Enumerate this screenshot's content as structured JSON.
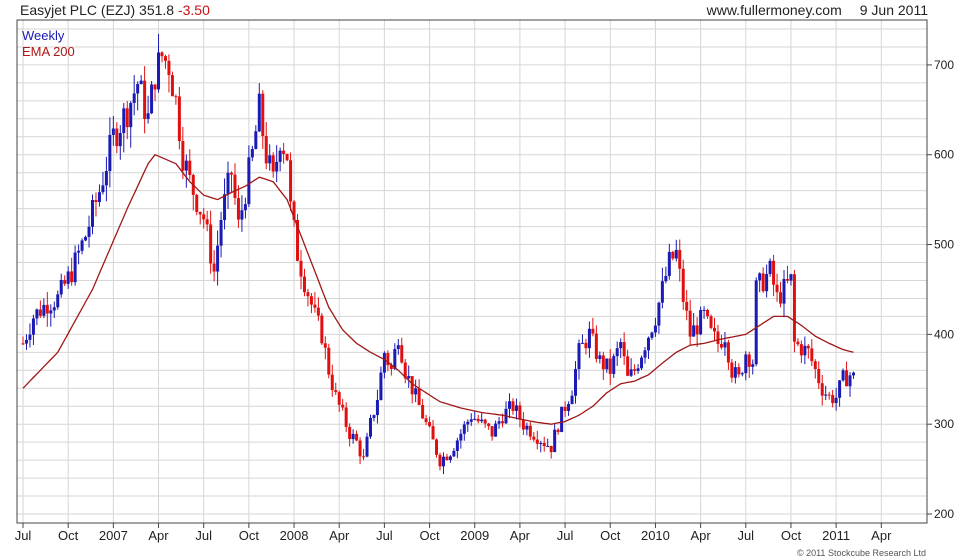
{
  "header": {
    "title": "Easyjet PLC (EZJ) 351.8",
    "change": "-3.50",
    "site": "www.fullermoney.com",
    "date": "9 Jun 2011"
  },
  "legend": {
    "weekly": "Weekly",
    "ema": "EMA 200"
  },
  "footer": {
    "copyright": "© 2011 Stockcube Research Ltd"
  },
  "colors": {
    "up_candle": "#1a1ab4",
    "down_candle": "#e01010",
    "ema_line": "#a01818",
    "grid": "#d6d6d6",
    "axis": "#444444"
  },
  "chart_data": {
    "type": "candlestick",
    "grid": true,
    "ylim": [
      190,
      750
    ],
    "y_axis_side": "right",
    "y_ticks": [
      200,
      300,
      400,
      500,
      600,
      700
    ],
    "x_ticks": [
      "Jul",
      "Oct",
      "2007",
      "Apr",
      "Jul",
      "Oct",
      "2008",
      "Apr",
      "Jul",
      "Oct",
      "2009",
      "Apr",
      "Jul",
      "Oct",
      "2010",
      "Apr",
      "Jul",
      "Oct",
      "2011",
      "Apr"
    ],
    "x_tick_weeks": [
      0,
      13,
      26,
      39,
      52,
      65,
      78,
      91,
      104,
      117,
      130,
      143,
      156,
      169,
      182,
      195,
      208,
      221,
      234,
      247
    ],
    "weeks": 259,
    "price_anchors": [
      [
        0,
        390
      ],
      [
        3,
        420
      ],
      [
        7,
        435
      ],
      [
        10,
        440
      ],
      [
        14,
        470
      ],
      [
        18,
        510
      ],
      [
        22,
        560
      ],
      [
        26,
        620
      ],
      [
        30,
        650
      ],
      [
        33,
        680
      ],
      [
        36,
        640
      ],
      [
        38,
        690
      ],
      [
        40,
        710
      ],
      [
        42,
        700
      ],
      [
        44,
        660
      ],
      [
        46,
        600
      ],
      [
        48,
        570
      ],
      [
        52,
        530
      ],
      [
        55,
        470
      ],
      [
        57,
        530
      ],
      [
        60,
        580
      ],
      [
        62,
        520
      ],
      [
        64,
        560
      ],
      [
        66,
        600
      ],
      [
        68,
        650
      ],
      [
        70,
        600
      ],
      [
        72,
        570
      ],
      [
        74,
        620
      ],
      [
        76,
        600
      ],
      [
        77,
        540
      ],
      [
        79,
        490
      ],
      [
        81,
        460
      ],
      [
        84,
        420
      ],
      [
        86,
        400
      ],
      [
        88,
        360
      ],
      [
        90,
        330
      ],
      [
        92,
        310
      ],
      [
        94,
        290
      ],
      [
        96,
        280
      ],
      [
        98,
        260
      ],
      [
        100,
        300
      ],
      [
        102,
        330
      ],
      [
        104,
        380
      ],
      [
        106,
        360
      ],
      [
        108,
        400
      ],
      [
        110,
        360
      ],
      [
        112,
        340
      ],
      [
        115,
        310
      ],
      [
        118,
        280
      ],
      [
        120,
        260
      ],
      [
        123,
        270
      ],
      [
        126,
        290
      ],
      [
        129,
        310
      ],
      [
        132,
        300
      ],
      [
        135,
        290
      ],
      [
        138,
        310
      ],
      [
        141,
        320
      ],
      [
        144,
        300
      ],
      [
        147,
        290
      ],
      [
        150,
        280
      ],
      [
        152,
        275
      ],
      [
        154,
        300
      ],
      [
        156,
        320
      ],
      [
        158,
        340
      ],
      [
        160,
        380
      ],
      [
        163,
        400
      ],
      [
        166,
        370
      ],
      [
        169,
        360
      ],
      [
        172,
        390
      ],
      [
        174,
        350
      ],
      [
        176,
        360
      ],
      [
        178,
        380
      ],
      [
        180,
        400
      ],
      [
        182,
        420
      ],
      [
        184,
        450
      ],
      [
        186,
        480
      ],
      [
        188,
        490
      ],
      [
        190,
        440
      ],
      [
        192,
        400
      ],
      [
        194,
        410
      ],
      [
        196,
        420
      ],
      [
        198,
        400
      ],
      [
        200,
        390
      ],
      [
        202,
        400
      ],
      [
        204,
        360
      ],
      [
        206,
        350
      ],
      [
        208,
        380
      ],
      [
        210,
        370
      ],
      [
        211,
        450
      ],
      [
        213,
        460
      ],
      [
        215,
        470
      ],
      [
        217,
        440
      ],
      [
        219,
        450
      ],
      [
        221,
        460
      ],
      [
        222,
        390
      ],
      [
        224,
        385
      ],
      [
        226,
        380
      ],
      [
        228,
        360
      ],
      [
        230,
        340
      ],
      [
        232,
        330
      ],
      [
        234,
        330
      ],
      [
        236,
        350
      ],
      [
        238,
        355
      ],
      [
        239,
        352
      ]
    ],
    "ema_anchors": [
      [
        0,
        340
      ],
      [
        10,
        380
      ],
      [
        20,
        450
      ],
      [
        30,
        540
      ],
      [
        36,
        590
      ],
      [
        38,
        600
      ],
      [
        44,
        590
      ],
      [
        48,
        570
      ],
      [
        52,
        555
      ],
      [
        56,
        550
      ],
      [
        60,
        558
      ],
      [
        64,
        565
      ],
      [
        68,
        575
      ],
      [
        72,
        570
      ],
      [
        76,
        550
      ],
      [
        80,
        510
      ],
      [
        84,
        470
      ],
      [
        88,
        430
      ],
      [
        92,
        405
      ],
      [
        96,
        390
      ],
      [
        100,
        380
      ],
      [
        104,
        372
      ],
      [
        108,
        360
      ],
      [
        112,
        345
      ],
      [
        116,
        335
      ],
      [
        120,
        325
      ],
      [
        126,
        318
      ],
      [
        132,
        313
      ],
      [
        138,
        310
      ],
      [
        144,
        305
      ],
      [
        148,
        302
      ],
      [
        152,
        300
      ],
      [
        156,
        303
      ],
      [
        160,
        310
      ],
      [
        164,
        320
      ],
      [
        168,
        335
      ],
      [
        172,
        345
      ],
      [
        176,
        348
      ],
      [
        180,
        355
      ],
      [
        184,
        368
      ],
      [
        188,
        380
      ],
      [
        192,
        388
      ],
      [
        196,
        390
      ],
      [
        200,
        394
      ],
      [
        204,
        397
      ],
      [
        208,
        400
      ],
      [
        212,
        410
      ],
      [
        216,
        420
      ],
      [
        220,
        420
      ],
      [
        224,
        410
      ],
      [
        228,
        398
      ],
      [
        232,
        390
      ],
      [
        236,
        383
      ],
      [
        239,
        380
      ]
    ]
  }
}
